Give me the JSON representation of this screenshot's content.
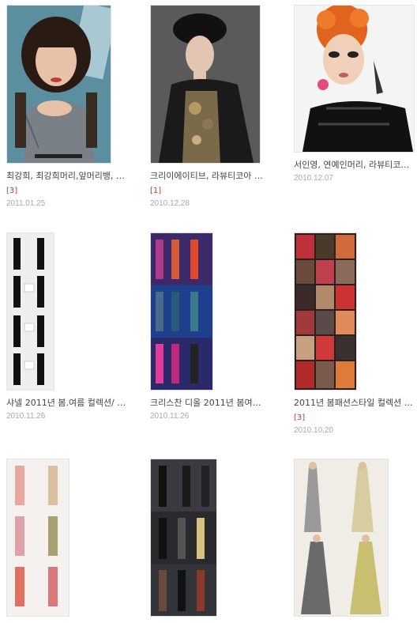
{
  "posts": [
    {
      "title": "최강희, 최강희머리,앞머리뱅, …",
      "count": "[3]",
      "date": "2011.01.25",
      "image": "photo: model with straight bangs, gray checked dress"
    },
    {
      "title": "크리이에이티브, 라뷰티코아 …",
      "count": "[1]",
      "date": "2010.12.28",
      "image": "photo: model with sculpted updo, black fur coat"
    },
    {
      "title": "서인영, 연예인머리, 라뷰티코…",
      "count": "",
      "date": "2010.12.07",
      "image": "photo: orange curly hair, black leather top"
    },
    {
      "title": "샤넬 2011년 봄.여름 컬렉션/ …",
      "count": "",
      "date": "2010.11.26",
      "image": "collage: black and white runway looks"
    },
    {
      "title": "크리스찬 디올 2011년 봄여…",
      "count": "",
      "date": "2010.11.26",
      "image": "collage: colorful runway looks"
    },
    {
      "title": "2011년 봄패션스타일 컬렉션 …",
      "count": "[3]",
      "date": "2010.10.20",
      "image": "collage: red bags and accessories"
    },
    {
      "title": "",
      "count": "",
      "date": "",
      "image": "collage: pastel floral runway dresses"
    },
    {
      "title": "",
      "count": "",
      "date": "",
      "image": "collage: dark runway looks"
    },
    {
      "title": "",
      "count": "",
      "date": "",
      "image": "collage: grey and gold gowns"
    }
  ]
}
